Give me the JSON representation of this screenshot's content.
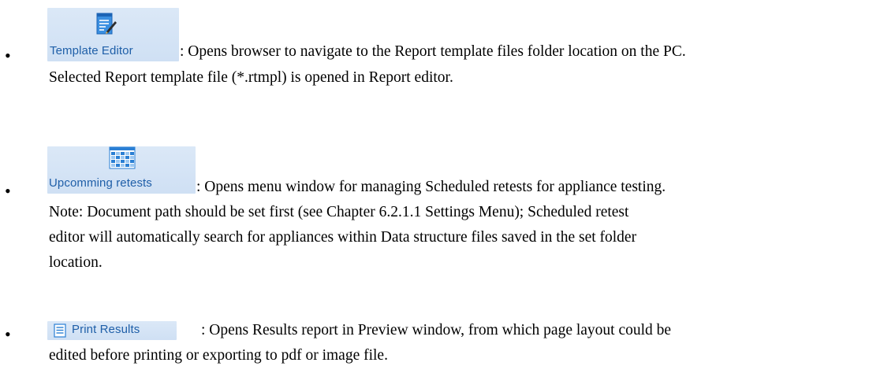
{
  "items": [
    {
      "button_label": "Template Editor",
      "icon": "template-editor-icon",
      "line1": ": Opens browser to navigate to the Report template files folder location on the PC.",
      "line2": "Selected Report template file (*.rtmpl) is opened in Report editor."
    },
    {
      "button_label": "Upcomming retests",
      "icon": "calendar-grid-icon",
      "line1": ": Opens menu window for managing Scheduled retests for appliance testing.",
      "line2": "Note: Document path should be set first (see Chapter 6.2.1.1 Settings Menu); Scheduled retest",
      "line3": "editor will automatically search for appliances within Data structure files saved in the set folder",
      "line4": "location."
    },
    {
      "button_label": "Print Results",
      "icon": "document-lines-icon",
      "line1": ": Opens Results report in Preview window, from which page layout could be",
      "line2": "edited before printing or exporting to pdf or image file."
    }
  ],
  "colors": {
    "button_bg": "#d7e6f7",
    "button_text": "#1f5fa8",
    "icon_blue": "#2a7fd4"
  }
}
